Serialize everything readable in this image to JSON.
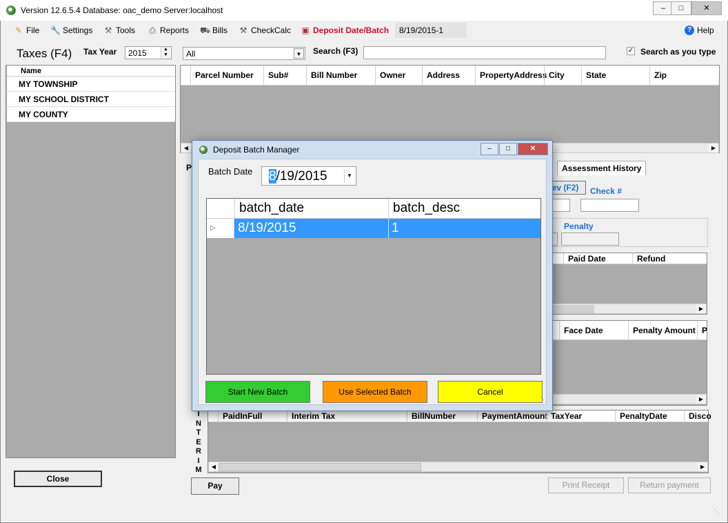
{
  "app": {
    "title": "Version 12.6.5.4 Database: oac_demo Server:localhost"
  },
  "menu": {
    "items": [
      {
        "label": "File",
        "icon": "pencil-icon"
      },
      {
        "label": "Settings",
        "icon": "wrench-icon"
      },
      {
        "label": "Tools",
        "icon": "tools-icon"
      },
      {
        "label": "Reports",
        "icon": "printer-icon"
      },
      {
        "label": "Bills",
        "icon": "car-icon"
      },
      {
        "label": "CheckCalc",
        "icon": "tool-icon"
      },
      {
        "label": "Deposit Date/Batch",
        "icon": "box-icon"
      }
    ],
    "active_batch": "8/19/2015-1",
    "help_label": "Help"
  },
  "toolbar": {
    "taxes_label": "Taxes (F4)",
    "tax_year_label": "Tax Year",
    "tax_year_value": "2015",
    "filter_value": "All",
    "search_label": "Search (F3)",
    "search_value": "",
    "search_as_you_type_label": "Search as you type",
    "search_as_you_type_checked": true
  },
  "districts": {
    "header": "Name",
    "rows": [
      "MY TOWNSHIP",
      "MY SCHOOL DISTRICT",
      "MY COUNTY"
    ]
  },
  "parcel_grid": {
    "columns": [
      "Parcel Number",
      "Sub#",
      "Bill Number",
      "Owner",
      "Address",
      "PropertyAddress",
      "City",
      "State",
      "Zip"
    ]
  },
  "tabs": {
    "partial_left": "P",
    "assessment_history": "Assessment History",
    "prev_partial": "ev (F2)",
    "check_label": "Check #",
    "penalty_label": "Penalty"
  },
  "payments_grid": {
    "columns": [
      "Paid Date",
      "Refund"
    ]
  },
  "face_grid": {
    "columns": [
      "Face Date",
      "Penalty Amount",
      "P"
    ]
  },
  "interim_grid": {
    "side_label": [
      "I",
      "N",
      "T",
      "E",
      "R",
      "I",
      "M"
    ],
    "columns": [
      "PaidInFull",
      "Interim Tax",
      "BillNumber",
      "PaymentAmount",
      "TaxYear",
      "PenaltyDate",
      "Disco"
    ]
  },
  "buttons": {
    "close": "Close",
    "pay": "Pay",
    "print_receipt": "Print Receipt",
    "return_payment": "Return payment"
  },
  "dialog": {
    "title": "Deposit Batch Manager",
    "batch_date_label": "Batch Date",
    "batch_date_value_first": "8",
    "batch_date_value_rest": "/19/2015",
    "columns": [
      "batch_date",
      "batch_desc"
    ],
    "rows": [
      {
        "batch_date": "8/19/2015",
        "batch_desc": "1"
      }
    ],
    "start_new_batch": "Start New Batch",
    "use_selected_batch": "Use Selected Batch",
    "cancel": "Cancel"
  },
  "colors": {
    "selection": "#3399ff",
    "start_button": "#33cc33",
    "use_button": "#ff9900",
    "cancel_button": "#ffff00",
    "deposit_menu": "#c8102e",
    "grid_bg": "#ababab"
  }
}
